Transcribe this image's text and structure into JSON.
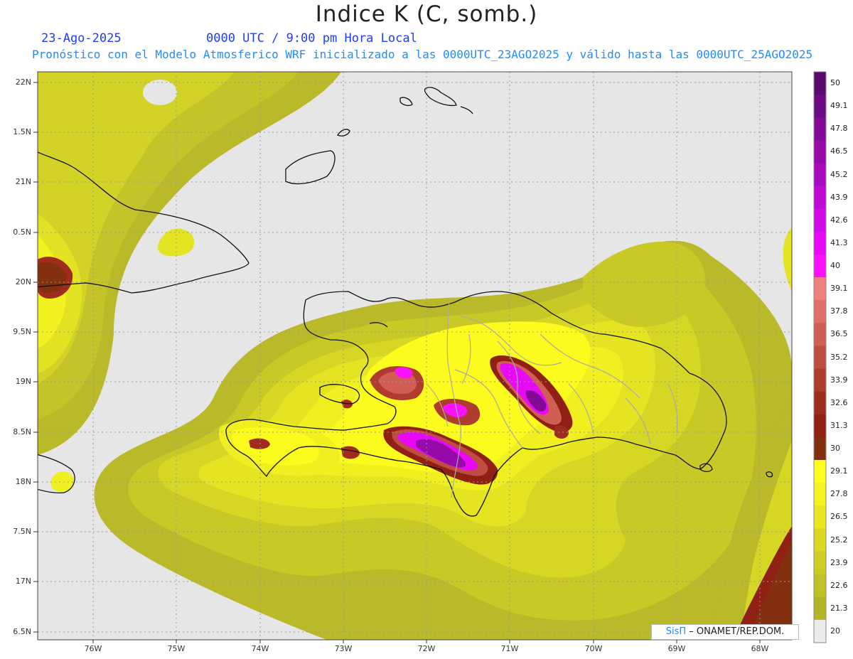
{
  "header": {
    "title": "Indice K (C, somb.)",
    "date": "23-Ago-2025",
    "time_info": "0000 UTC / 9:00 pm Hora Local",
    "subtitle": "Pronóstico con el Modelo Atmosferico WRF inicializado a las 0000UTC_23AGO2025 y válido hasta las  0000UTC_25AGO2025"
  },
  "axes": {
    "lat_labels": [
      "22N",
      "1.5N",
      "21N",
      "0.5N",
      "20N",
      "9.5N",
      "19N",
      "8.5N",
      "18N",
      "7.5N",
      "17N",
      "6.5N"
    ],
    "lon_labels": [
      "76W",
      "75W",
      "74W",
      "73W",
      "72W",
      "71W",
      "70W",
      "69W",
      "68W"
    ]
  },
  "colorbar": {
    "labels": [
      "50",
      "49.1",
      "47.8",
      "46.5",
      "45.2",
      "43.9",
      "42.6",
      "41.3",
      "40",
      "39.1",
      "37.8",
      "36.5",
      "35.2",
      "33.9",
      "32.6",
      "31.3",
      "30",
      "29.1",
      "27.8",
      "26.5",
      "25.2",
      "23.9",
      "22.6",
      "21.3",
      "20"
    ],
    "colors": [
      "#5a0a6e",
      "#6e0a82",
      "#820a96",
      "#960aaa",
      "#aa0abe",
      "#be0ad2",
      "#d20ae6",
      "#e60af5",
      "#fa12ff",
      "#f08080",
      "#e06f6a",
      "#d05e55",
      "#c04d42",
      "#b03c30",
      "#a02c20",
      "#902014",
      "#82300f",
      "#ffff1e",
      "#f3f320",
      "#e6e622",
      "#d9d924",
      "#cccc25",
      "#c0c027",
      "#b4b428",
      "#ebebeb"
    ]
  },
  "credit": {
    "sis": "SisΠ",
    "org": "– ONAMET/REP.DOM."
  },
  "colors": {
    "background_no_data": "#e6e6e6",
    "title_blue": "#1f3cff",
    "subtitle_blue": "#1f8cff"
  }
}
